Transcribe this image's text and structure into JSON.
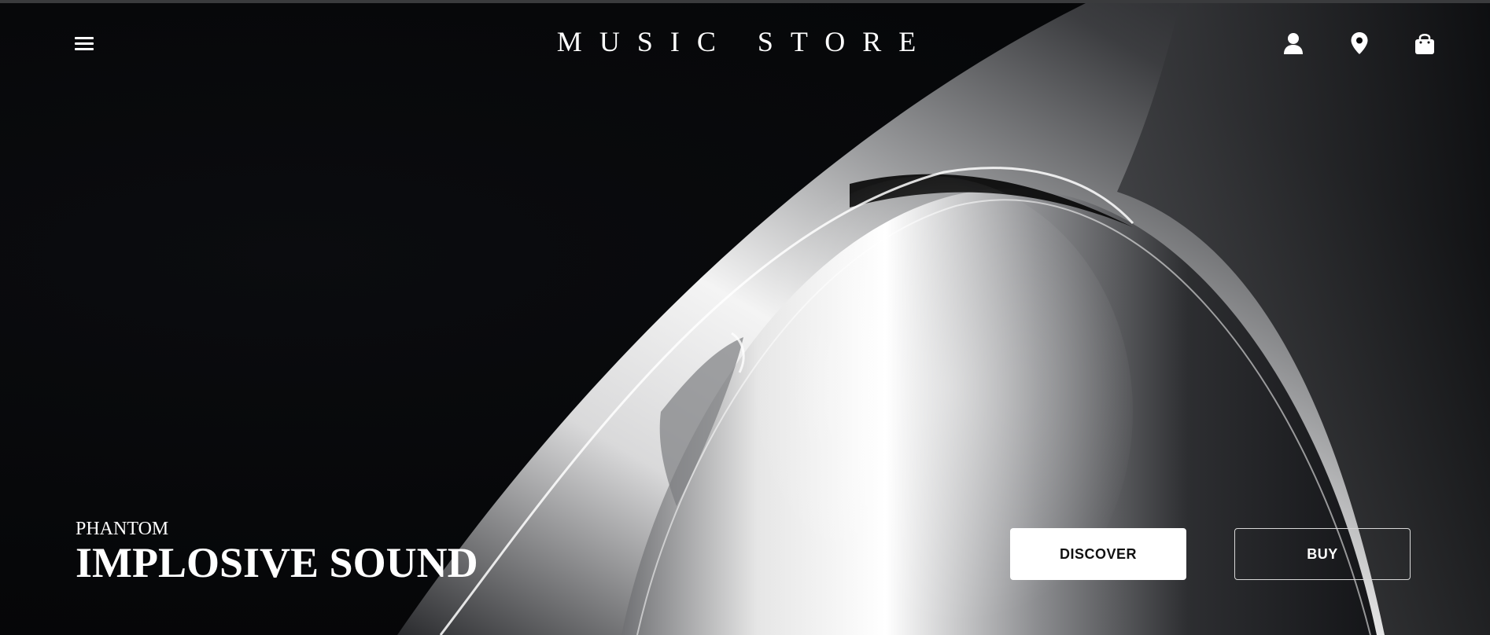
{
  "header": {
    "brand": "MUSIC STORE",
    "menu_icon": "hamburger-menu-icon",
    "account_icon": "user-icon",
    "location_icon": "location-pin-icon",
    "bag_icon": "shopping-bag-icon"
  },
  "hero": {
    "eyebrow": "PHANTOM",
    "headline": "IMPLOSIVE SOUND",
    "discover_label": "DISCOVER",
    "buy_label": "BUY"
  },
  "colors": {
    "background": "#050608",
    "text": "#ffffff",
    "button_primary_bg": "#ffffff",
    "button_primary_text": "#111111",
    "button_outline_border": "#d8d8d8"
  }
}
